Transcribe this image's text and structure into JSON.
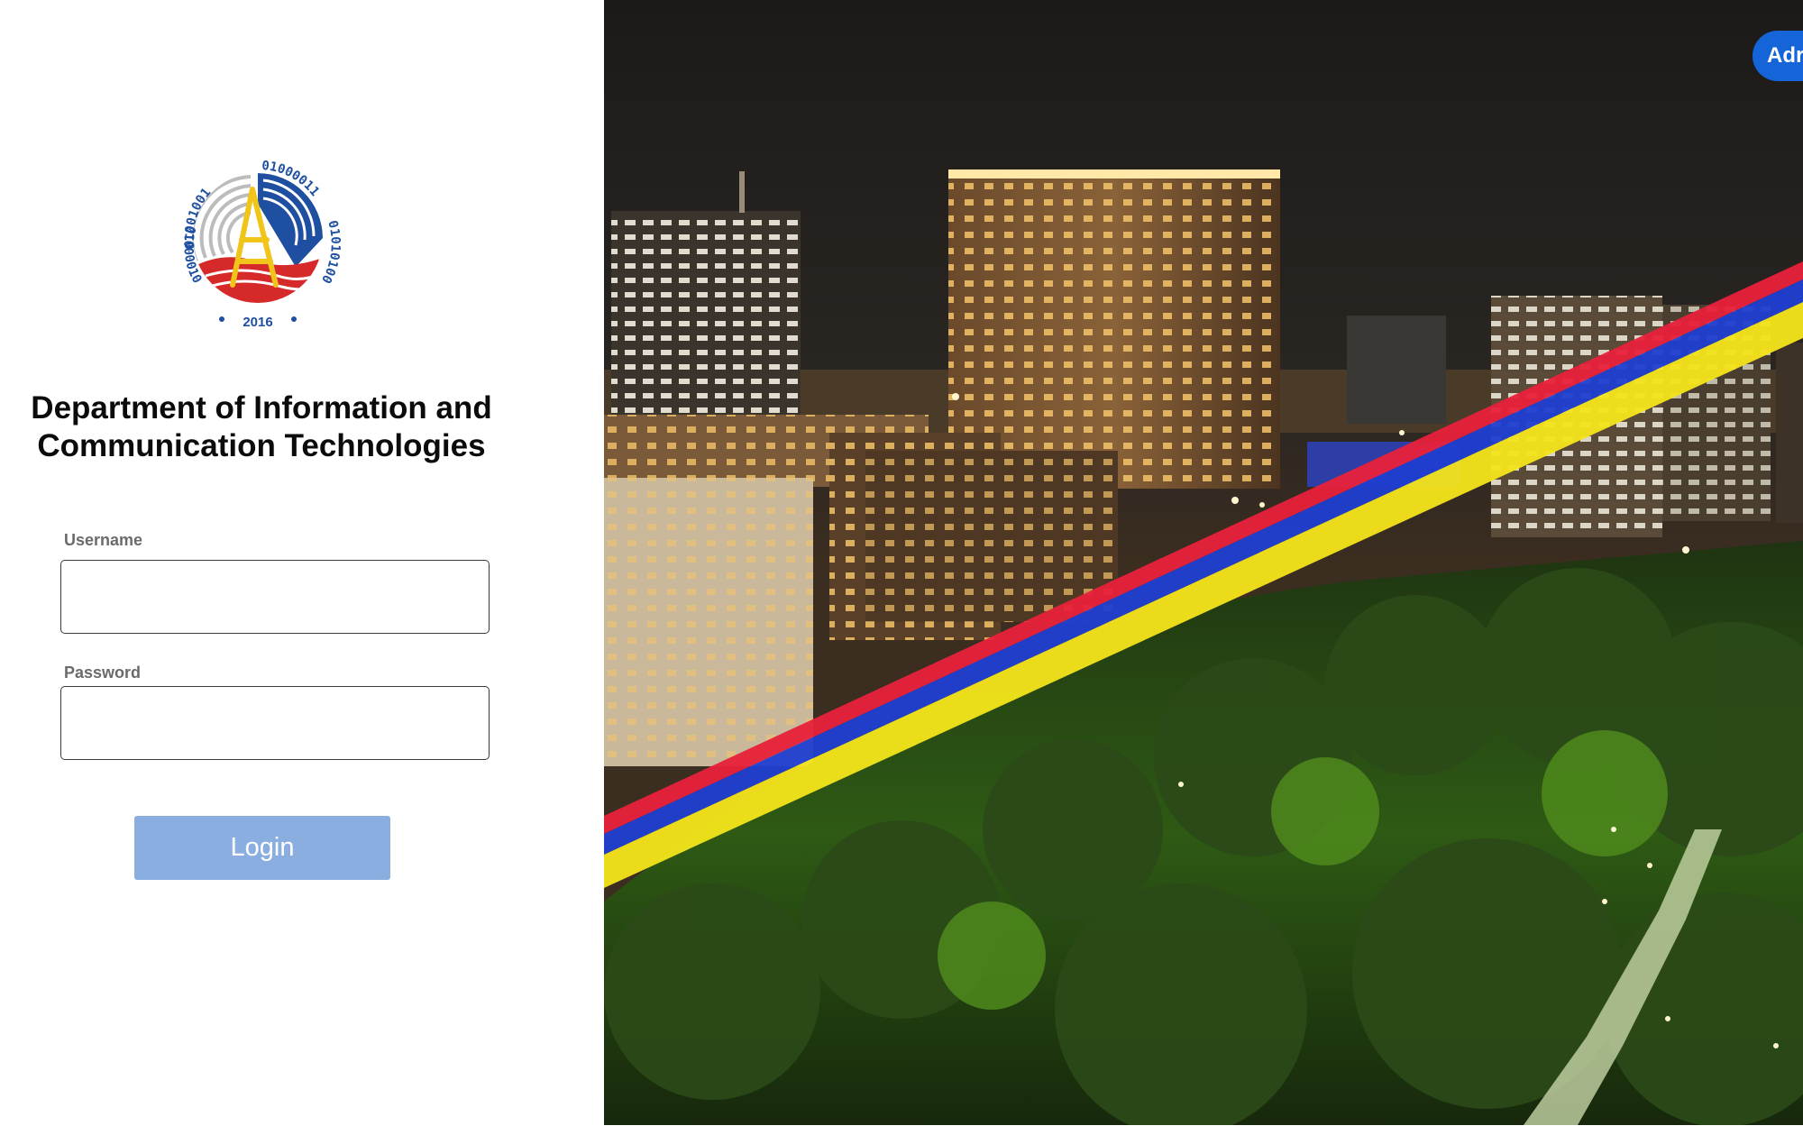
{
  "branding": {
    "org_name": "Department of Information and Communication Technologies",
    "logo": {
      "binary_left": "01001001",
      "binary_top_right": "01000011",
      "binary_right": "01010100",
      "binary_left_lower": "01000010",
      "year": "2016",
      "colors": {
        "blue": "#1e4fa0",
        "red": "#d62a2a",
        "yellow": "#f0c419",
        "gray": "#bcbcbc"
      }
    }
  },
  "login_form": {
    "username_label": "Username",
    "username_value": "",
    "password_label": "Password",
    "password_value": "",
    "login_label": "Login"
  },
  "header": {
    "admin_button_label": "Adr"
  },
  "colors": {
    "login_button": "#8aaee0",
    "admin_button": "#1565d8",
    "ribbon_red": "#e8213b",
    "ribbon_blue": "#1f3fd1",
    "ribbon_yellow": "#f5e51b"
  }
}
